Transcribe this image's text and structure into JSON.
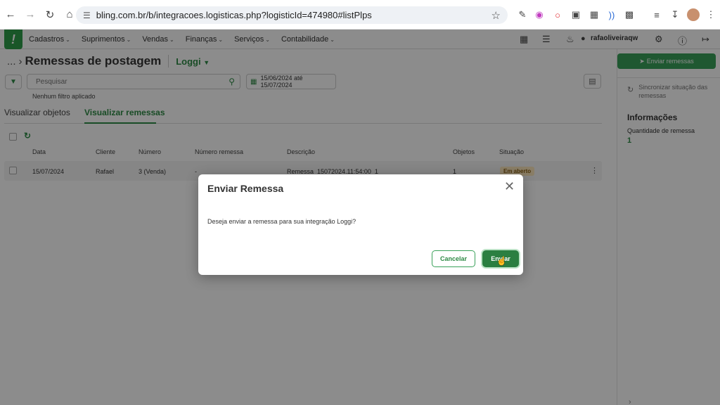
{
  "browser": {
    "url": "bling.com.br/b/integracoes.logisticas.php?logisticId=474980#listPlps"
  },
  "nav": {
    "menu": [
      {
        "label": "Cadastros"
      },
      {
        "label": "Suprimentos"
      },
      {
        "label": "Vendas"
      },
      {
        "label": "Finanças"
      },
      {
        "label": "Serviços"
      },
      {
        "label": "Contabilidade"
      }
    ],
    "username": "rafaoliveiraqw"
  },
  "page": {
    "breadcrumb": "...",
    "title": "Remessas de postagem",
    "integration": "Loggi",
    "search_placeholder": "Pesquisar",
    "date_range": "15/06/2024 até 15/07/2024",
    "no_filter": "Nenhum filtro aplicado",
    "tabs": [
      {
        "label": "Visualizar objetos"
      },
      {
        "label": "Visualizar remessas"
      }
    ]
  },
  "table": {
    "headers": [
      "Data",
      "Cliente",
      "Número",
      "Número remessa",
      "Descrição",
      "Objetos",
      "Situação"
    ],
    "rows": [
      {
        "data": "15/07/2024",
        "cliente": "Rafael",
        "numero": "3 (Venda)",
        "numero_remessa": "-",
        "descricao": "Remessa_15072024.11:54:00_1",
        "objetos": "1",
        "situacao": "Em aberto"
      }
    ]
  },
  "right_panel": {
    "send_button": "Enviar remessas",
    "sync_text": "Sincronizar situação das remessas",
    "info_title": "Informações",
    "qty_label": "Quantidade de remessa",
    "qty_value": "1"
  },
  "modal": {
    "title": "Enviar Remessa",
    "message": "Deseja enviar a remessa para sua integração Loggi?",
    "cancel": "Cancelar",
    "confirm": "Enviar"
  },
  "colors": {
    "brand_green": "#2e9d4a",
    "status_badge_bg": "#fbe6bc"
  }
}
